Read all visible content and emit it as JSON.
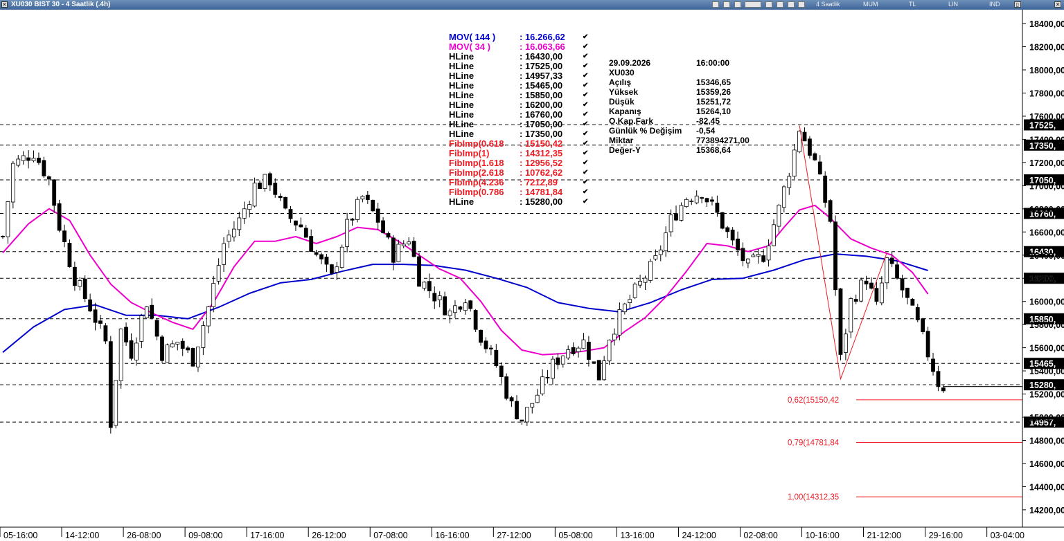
{
  "window": {
    "title": "XU030 BIST 30 - 4 Saatlik (.4h)",
    "close_glyph": "×",
    "toolbar": {
      "period": "4 Saatlik",
      "chart_style": "MUM",
      "currency": "TL",
      "scale": "LIN",
      "mode": "IND",
      "restore_glyph": "▯",
      "close_glyph": "×"
    }
  },
  "colors": {
    "mov144": "#0000cc",
    "mov34": "#ee00cc",
    "fib": "#ee1c24",
    "hline": "#000000",
    "candle_up": "#ffffff",
    "candle_down": "#000000",
    "label_box": "#000000"
  },
  "indicators": [
    {
      "name": "MOV( 144 )",
      "value": ": 16.266,62",
      "color": "#0000cc"
    },
    {
      "name": "MOV( 34 )",
      "value": ": 16.063,66",
      "color": "#ee00cc"
    },
    {
      "name": "HLine",
      "value": ": 16430,00",
      "color": "#000000"
    },
    {
      "name": "HLine",
      "value": ": 17525,00",
      "color": "#000000"
    },
    {
      "name": "HLine",
      "value": ": 14957,33",
      "color": "#000000"
    },
    {
      "name": "HLine",
      "value": ": 15465,00",
      "color": "#000000"
    },
    {
      "name": "HLine",
      "value": ": 15850,00",
      "color": "#000000"
    },
    {
      "name": "HLine",
      "value": ": 16200,00",
      "color": "#000000"
    },
    {
      "name": "HLine",
      "value": ": 16760,00",
      "color": "#000000"
    },
    {
      "name": "HLine",
      "value": ": 17050,00",
      "color": "#000000"
    },
    {
      "name": "HLine",
      "value": ": 17350,00",
      "color": "#000000"
    },
    {
      "name": "FibImp(0.618",
      "value": ": 15150,42",
      "color": "#ee1c24"
    },
    {
      "name": "FibImp(1)",
      "value": ": 14312,35",
      "color": "#ee1c24"
    },
    {
      "name": "FibImp(1.618",
      "value": ": 12956,52",
      "color": "#ee1c24"
    },
    {
      "name": "FibImp(2.618",
      "value": ": 10762,62",
      "color": "#ee1c24"
    },
    {
      "name": "FibImp(4.236",
      "value": ": 7212,89",
      "color": "#ee1c24"
    },
    {
      "name": "FibImp(0.786",
      "value": ": 14781,84",
      "color": "#ee1c24"
    },
    {
      "name": "HLine",
      "value": ": 15280,00",
      "color": "#000000"
    }
  ],
  "check_glyph": "✔",
  "info": [
    {
      "key": "29.09.2026",
      "value": "16:00:00"
    },
    {
      "key": "XU030",
      "value": ""
    },
    {
      "key": "Açılış",
      "value": "15346,65"
    },
    {
      "key": "Yüksek",
      "value": "15359,26"
    },
    {
      "key": "Düşük",
      "value": "15251,72"
    },
    {
      "key": "Kapanış",
      "value": "15264,10"
    },
    {
      "key": "O.Kap.Fark",
      "value": "-82,45"
    },
    {
      "key": "Günlük % Değişim",
      "value": "-0,54"
    },
    {
      "key": "Miktar",
      "value": "773894271,00"
    },
    {
      "key": "Değer-Y",
      "value": "15368,64"
    }
  ],
  "chart_data": {
    "type": "candlestick",
    "y_axis": {
      "range": [
        14050,
        18520
      ],
      "ticks": [
        {
          "value": 18400,
          "label": "18400,00"
        },
        {
          "value": 18200,
          "label": "18200,00"
        },
        {
          "value": 18000,
          "label": "18000,00"
        },
        {
          "value": 17800,
          "label": "17800,00"
        },
        {
          "value": 17600,
          "label": "17600,00"
        },
        {
          "value": 17400,
          "label": "17400,00"
        },
        {
          "value": 17200,
          "label": "17200,00"
        },
        {
          "value": 17000,
          "label": "17000,00"
        },
        {
          "value": 16800,
          "label": "16800,00"
        },
        {
          "value": 16600,
          "label": "16600,00"
        },
        {
          "value": 16400,
          "label": "16400,00"
        },
        {
          "value": 16200,
          "label": "16200,00"
        },
        {
          "value": 16000,
          "label": "16000,00"
        },
        {
          "value": 15800,
          "label": "15800,00"
        },
        {
          "value": 15600,
          "label": "15600,00"
        },
        {
          "value": 15400,
          "label": "15400,00"
        },
        {
          "value": 15200,
          "label": "15200,00"
        },
        {
          "value": 15000,
          "label": "15000,00"
        },
        {
          "value": 14800,
          "label": "14800,00"
        },
        {
          "value": 14600,
          "label": "14600,00"
        },
        {
          "value": 14400,
          "label": "14400,00"
        },
        {
          "value": 14200,
          "label": "14200,00"
        }
      ]
    },
    "x_axis": {
      "bars_total": 205,
      "ticks": [
        {
          "bar": 0,
          "label": "05-16:00"
        },
        {
          "bar": 12,
          "label": "14-12:00"
        },
        {
          "bar": 24,
          "label": "26-08:00"
        },
        {
          "bar": 36,
          "label": "09-08:00"
        },
        {
          "bar": 48,
          "label": "17-16:00"
        },
        {
          "bar": 60,
          "label": "26-12:00"
        },
        {
          "bar": 72,
          "label": "07-08:00"
        },
        {
          "bar": 84,
          "label": "16-16:00"
        },
        {
          "bar": 96,
          "label": "27-12:00"
        },
        {
          "bar": 108,
          "label": "05-08:00"
        },
        {
          "bar": 120,
          "label": "13-16:00"
        },
        {
          "bar": 132,
          "label": "24-12:00"
        },
        {
          "bar": 144,
          "label": "02-08:00"
        },
        {
          "bar": 156,
          "label": "10-16:00"
        },
        {
          "bar": 168,
          "label": "21-12:00"
        },
        {
          "bar": 180,
          "label": "29-16:00"
        },
        {
          "bar": 192,
          "label": "03-04:00"
        }
      ]
    },
    "hlines": [
      {
        "value": 17525,
        "label": "17525,"
      },
      {
        "value": 17350,
        "label": "17350,"
      },
      {
        "value": 17050,
        "label": "17050,"
      },
      {
        "value": 16760,
        "label": "16760,"
      },
      {
        "value": 16430,
        "label": "16430,"
      },
      {
        "value": 16200,
        "label": "16200,"
      },
      {
        "value": 15850,
        "label": "15850,"
      },
      {
        "value": 15465,
        "label": "15465,"
      },
      {
        "value": 15280,
        "label": "15280,"
      },
      {
        "value": 14957.33,
        "label": "14957,"
      }
    ],
    "fib_levels": [
      {
        "value": 15150.42,
        "label": "0,62(15150,42"
      },
      {
        "value": 14781.84,
        "label": "0,79(14781,84"
      },
      {
        "value": 14312.35,
        "label": "1,00(14312,35"
      }
    ],
    "fib_zigzag": [
      {
        "bar": 155,
        "value": 17520
      },
      {
        "bar": 163,
        "value": 15330
      },
      {
        "bar": 172,
        "value": 16420
      }
    ],
    "close_path": [
      {
        "bar": 0,
        "value": 16560
      },
      {
        "bar": 2,
        "value": 17180
      },
      {
        "bar": 6,
        "value": 17290
      },
      {
        "bar": 9,
        "value": 17050
      },
      {
        "bar": 11,
        "value": 16650
      },
      {
        "bar": 14,
        "value": 16200
      },
      {
        "bar": 17,
        "value": 15950
      },
      {
        "bar": 20,
        "value": 15650
      },
      {
        "bar": 21,
        "value": 14950
      },
      {
        "bar": 23,
        "value": 15750
      },
      {
        "bar": 25,
        "value": 15560
      },
      {
        "bar": 28,
        "value": 16000
      },
      {
        "bar": 31,
        "value": 15550
      },
      {
        "bar": 34,
        "value": 15650
      },
      {
        "bar": 37,
        "value": 15500
      },
      {
        "bar": 40,
        "value": 15950
      },
      {
        "bar": 43,
        "value": 16500
      },
      {
        "bar": 46,
        "value": 16700
      },
      {
        "bar": 49,
        "value": 17000
      },
      {
        "bar": 52,
        "value": 17050
      },
      {
        "bar": 55,
        "value": 16750
      },
      {
        "bar": 58,
        "value": 16650
      },
      {
        "bar": 61,
        "value": 16400
      },
      {
        "bar": 64,
        "value": 16200
      },
      {
        "bar": 67,
        "value": 16650
      },
      {
        "bar": 70,
        "value": 16900
      },
      {
        "bar": 73,
        "value": 16700
      },
      {
        "bar": 76,
        "value": 16400
      },
      {
        "bar": 79,
        "value": 16550
      },
      {
        "bar": 81,
        "value": 16200
      },
      {
        "bar": 84,
        "value": 16050
      },
      {
        "bar": 87,
        "value": 15900
      },
      {
        "bar": 90,
        "value": 16050
      },
      {
        "bar": 93,
        "value": 15700
      },
      {
        "bar": 96,
        "value": 15450
      },
      {
        "bar": 99,
        "value": 15100
      },
      {
        "bar": 101,
        "value": 14980
      },
      {
        "bar": 104,
        "value": 15200
      },
      {
        "bar": 107,
        "value": 15450
      },
      {
        "bar": 110,
        "value": 15600
      },
      {
        "bar": 113,
        "value": 15650
      },
      {
        "bar": 116,
        "value": 15350
      },
      {
        "bar": 118,
        "value": 15700
      },
      {
        "bar": 121,
        "value": 15950
      },
      {
        "bar": 124,
        "value": 16150
      },
      {
        "bar": 127,
        "value": 16350
      },
      {
        "bar": 130,
        "value": 16700
      },
      {
        "bar": 133,
        "value": 16900
      },
      {
        "bar": 136,
        "value": 16950
      },
      {
        "bar": 139,
        "value": 16750
      },
      {
        "bar": 142,
        "value": 16500
      },
      {
        "bar": 145,
        "value": 16300
      },
      {
        "bar": 148,
        "value": 16400
      },
      {
        "bar": 151,
        "value": 16800
      },
      {
        "bar": 154,
        "value": 17300
      },
      {
        "bar": 155,
        "value": 17500
      },
      {
        "bar": 158,
        "value": 17200
      },
      {
        "bar": 161,
        "value": 16700
      },
      {
        "bar": 163,
        "value": 15500
      },
      {
        "bar": 165,
        "value": 16000
      },
      {
        "bar": 168,
        "value": 16200
      },
      {
        "bar": 170,
        "value": 15950
      },
      {
        "bar": 172,
        "value": 16350
      },
      {
        "bar": 175,
        "value": 16100
      },
      {
        "bar": 178,
        "value": 15800
      },
      {
        "bar": 180,
        "value": 15550
      },
      {
        "bar": 182,
        "value": 15300
      },
      {
        "bar": 183,
        "value": 15265
      }
    ],
    "mov144": [
      {
        "bar": 0,
        "value": 15560
      },
      {
        "bar": 6,
        "value": 15780
      },
      {
        "bar": 12,
        "value": 15930
      },
      {
        "bar": 18,
        "value": 15970
      },
      {
        "bar": 24,
        "value": 15880
      },
      {
        "bar": 30,
        "value": 15880
      },
      {
        "bar": 36,
        "value": 15850
      },
      {
        "bar": 42,
        "value": 15950
      },
      {
        "bar": 48,
        "value": 16070
      },
      {
        "bar": 54,
        "value": 16160
      },
      {
        "bar": 60,
        "value": 16190
      },
      {
        "bar": 66,
        "value": 16260
      },
      {
        "bar": 72,
        "value": 16320
      },
      {
        "bar": 78,
        "value": 16320
      },
      {
        "bar": 84,
        "value": 16310
      },
      {
        "bar": 90,
        "value": 16270
      },
      {
        "bar": 96,
        "value": 16200
      },
      {
        "bar": 102,
        "value": 16120
      },
      {
        "bar": 108,
        "value": 15990
      },
      {
        "bar": 114,
        "value": 15940
      },
      {
        "bar": 120,
        "value": 15910
      },
      {
        "bar": 126,
        "value": 15990
      },
      {
        "bar": 132,
        "value": 16100
      },
      {
        "bar": 138,
        "value": 16190
      },
      {
        "bar": 144,
        "value": 16200
      },
      {
        "bar": 150,
        "value": 16270
      },
      {
        "bar": 156,
        "value": 16360
      },
      {
        "bar": 162,
        "value": 16410
      },
      {
        "bar": 168,
        "value": 16390
      },
      {
        "bar": 174,
        "value": 16350
      },
      {
        "bar": 180,
        "value": 16267
      }
    ],
    "mov34": [
      {
        "bar": 0,
        "value": 16420
      },
      {
        "bar": 5,
        "value": 16670
      },
      {
        "bar": 9,
        "value": 16800
      },
      {
        "bar": 13,
        "value": 16700
      },
      {
        "bar": 17,
        "value": 16400
      },
      {
        "bar": 21,
        "value": 16150
      },
      {
        "bar": 25,
        "value": 15990
      },
      {
        "bar": 29,
        "value": 15900
      },
      {
        "bar": 33,
        "value": 15820
      },
      {
        "bar": 37,
        "value": 15760
      },
      {
        "bar": 41,
        "value": 15990
      },
      {
        "bar": 45,
        "value": 16300
      },
      {
        "bar": 49,
        "value": 16520
      },
      {
        "bar": 53,
        "value": 16520
      },
      {
        "bar": 57,
        "value": 16560
      },
      {
        "bar": 61,
        "value": 16500
      },
      {
        "bar": 65,
        "value": 16560
      },
      {
        "bar": 69,
        "value": 16640
      },
      {
        "bar": 73,
        "value": 16620
      },
      {
        "bar": 77,
        "value": 16520
      },
      {
        "bar": 81,
        "value": 16400
      },
      {
        "bar": 85,
        "value": 16280
      },
      {
        "bar": 89,
        "value": 16200
      },
      {
        "bar": 93,
        "value": 16000
      },
      {
        "bar": 97,
        "value": 15750
      },
      {
        "bar": 101,
        "value": 15580
      },
      {
        "bar": 105,
        "value": 15540
      },
      {
        "bar": 109,
        "value": 15550
      },
      {
        "bar": 113,
        "value": 15570
      },
      {
        "bar": 117,
        "value": 15600
      },
      {
        "bar": 121,
        "value": 15740
      },
      {
        "bar": 125,
        "value": 15860
      },
      {
        "bar": 129,
        "value": 16040
      },
      {
        "bar": 133,
        "value": 16260
      },
      {
        "bar": 137,
        "value": 16500
      },
      {
        "bar": 141,
        "value": 16480
      },
      {
        "bar": 145,
        "value": 16430
      },
      {
        "bar": 149,
        "value": 16480
      },
      {
        "bar": 152,
        "value": 16640
      },
      {
        "bar": 155,
        "value": 16790
      },
      {
        "bar": 158,
        "value": 16830
      },
      {
        "bar": 161,
        "value": 16720
      },
      {
        "bar": 165,
        "value": 16540
      },
      {
        "bar": 169,
        "value": 16460
      },
      {
        "bar": 173,
        "value": 16400
      },
      {
        "bar": 177,
        "value": 16250
      },
      {
        "bar": 180,
        "value": 16064
      }
    ]
  }
}
